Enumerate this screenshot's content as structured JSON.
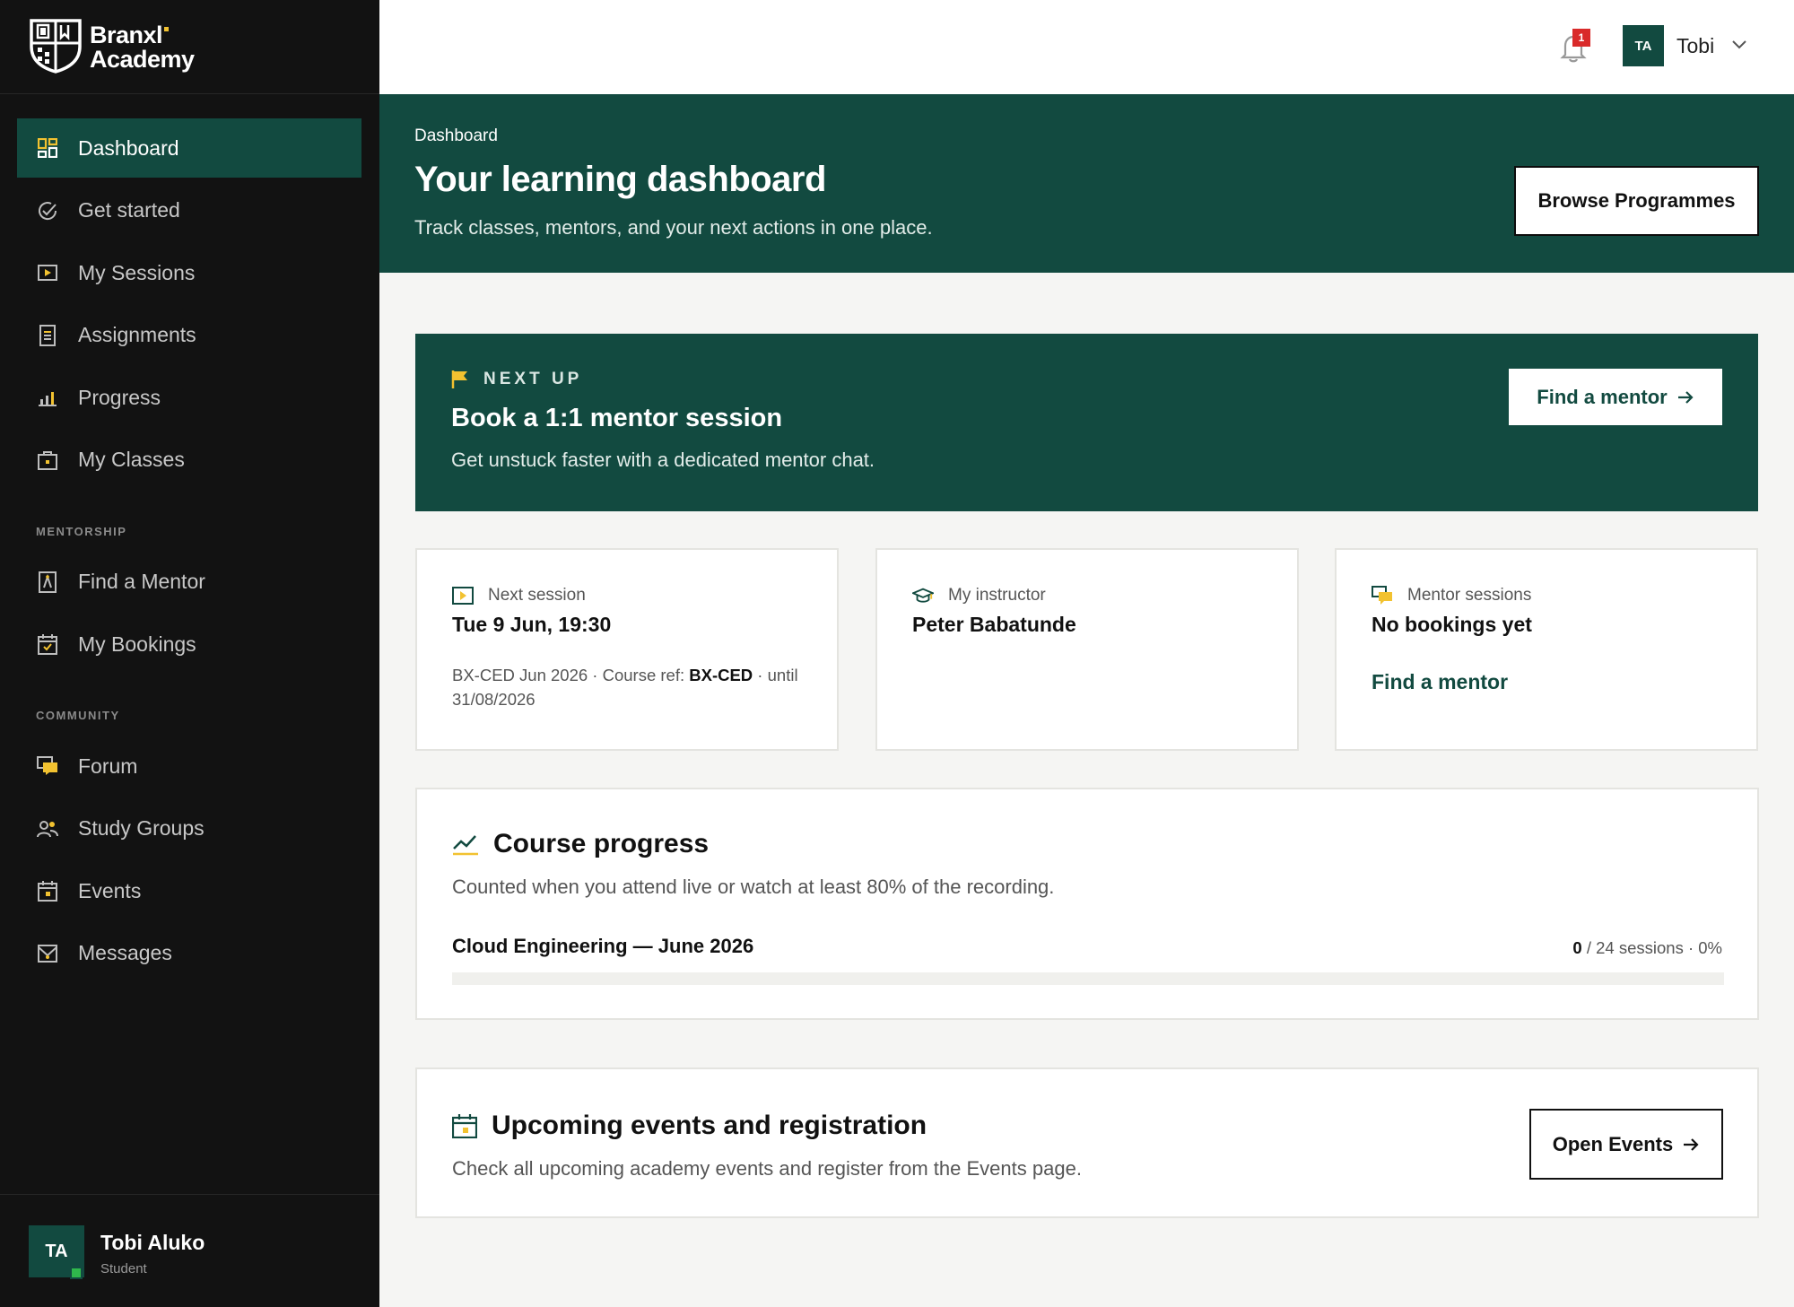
{
  "brand": {
    "line1": "Branxl",
    "line2": "Academy",
    "accent": "#f2c230",
    "primary": "#124a40"
  },
  "sidebar": {
    "main_items": [
      {
        "label": "Dashboard",
        "icon": "dashboard-icon",
        "active": true
      },
      {
        "label": "Get started",
        "icon": "check-circle-icon"
      },
      {
        "label": "My Sessions",
        "icon": "play-icon"
      },
      {
        "label": "Assignments",
        "icon": "document-icon"
      },
      {
        "label": "Progress",
        "icon": "bar-chart-icon"
      },
      {
        "label": "My Classes",
        "icon": "briefcase-icon"
      }
    ],
    "mentorship_heading": "MENTORSHIP",
    "mentorship_items": [
      {
        "label": "Find a Mentor",
        "icon": "person-icon"
      },
      {
        "label": "My Bookings",
        "icon": "calendar-check-icon"
      }
    ],
    "community_heading": "COMMUNITY",
    "community_items": [
      {
        "label": "Forum",
        "icon": "chat-icon"
      },
      {
        "label": "Study Groups",
        "icon": "group-icon"
      },
      {
        "label": "Events",
        "icon": "calendar-icon"
      },
      {
        "label": "Messages",
        "icon": "mail-icon"
      }
    ],
    "user": {
      "initials": "TA",
      "name": "Tobi Aluko",
      "role": "Student"
    }
  },
  "topbar": {
    "notification_count": "1",
    "avatar_initials": "TA",
    "user_name": "Tobi"
  },
  "hero": {
    "breadcrumb": "Dashboard",
    "title": "Your learning dashboard",
    "subtitle": "Track classes, mentors, and your next actions in one place.",
    "browse_button": "Browse Programmes"
  },
  "next_up": {
    "label": "NEXT UP",
    "title": "Book a 1:1 mentor session",
    "subtitle": "Get unstuck faster with a dedicated mentor chat.",
    "button": "Find a mentor"
  },
  "cards": {
    "next_session": {
      "label": "Next session",
      "value": "Tue 9 Jun, 19:30",
      "meta_prefix": "BX-CED Jun 2026 · Course ref: ",
      "meta_ref": "BX-CED",
      "meta_suffix": " · until 31/08/2026"
    },
    "instructor": {
      "label": "My instructor",
      "value": "Peter Babatunde"
    },
    "mentor_sessions": {
      "label": "Mentor sessions",
      "value": "No bookings yet",
      "link": "Find a mentor"
    }
  },
  "course_progress": {
    "title": "Course progress",
    "subtitle": "Counted when you attend live or watch at least 80% of the recording.",
    "course_name": "Cloud Engineering — June 2026",
    "attended": "0",
    "total_text": " / 24 sessions · 0%",
    "progress_fraction": 0
  },
  "events": {
    "title": "Upcoming events and registration",
    "subtitle": "Check all upcoming academy events and register from the Events page.",
    "button": "Open Events"
  }
}
